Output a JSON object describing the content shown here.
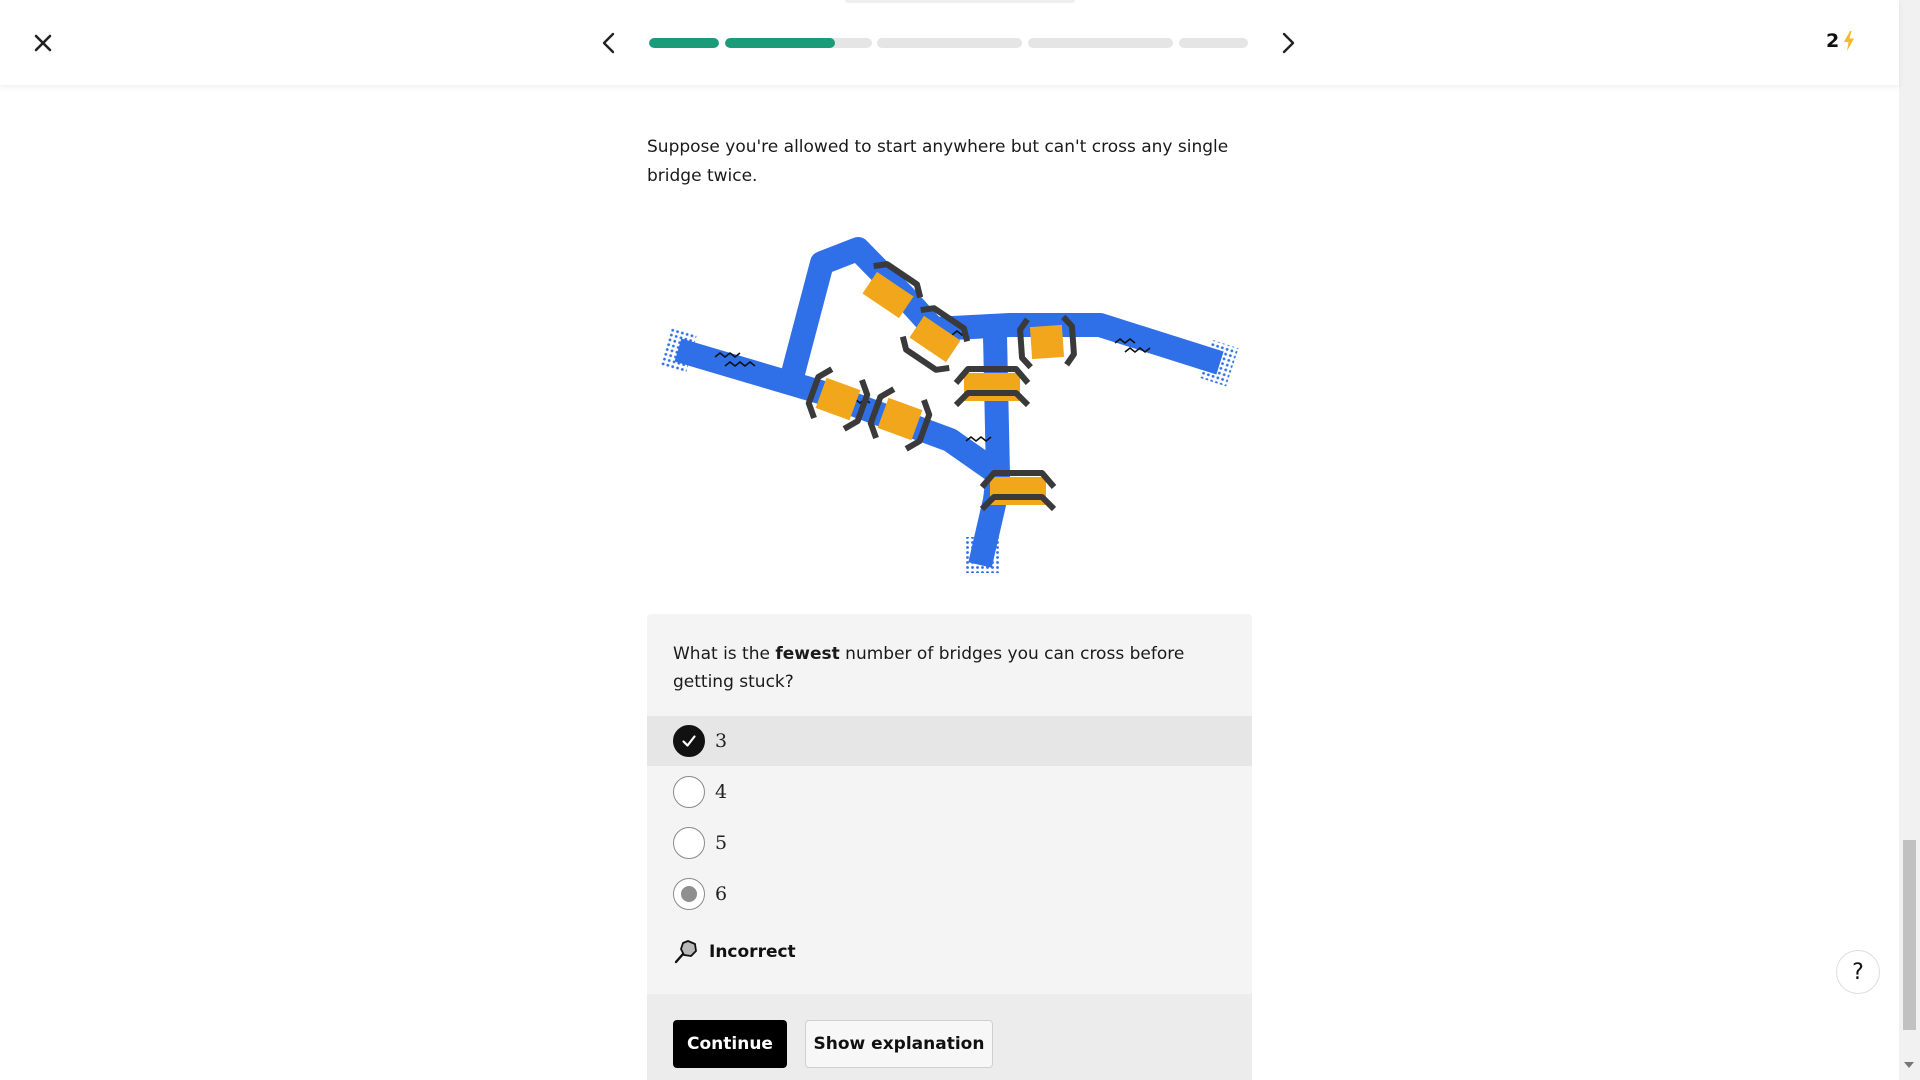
{
  "header": {
    "close_icon": "close-icon",
    "prev_icon": "chevron-left-icon",
    "next_icon": "chevron-right-icon",
    "progress_segments": [
      {
        "fill": 1.0
      },
      {
        "fill": 0.75
      },
      {
        "fill": 0.0
      },
      {
        "fill": 0.0
      },
      {
        "fill": 0.0
      }
    ],
    "energy_count": "2",
    "energy_icon": "lightning-bolt-icon",
    "accent_color": "#1a9c7a",
    "bolt_color": "#f5b82e"
  },
  "content": {
    "intro": "Suppose you're allowed to start anywhere but can't cross any single bridge twice."
  },
  "quiz": {
    "question_before": "What is the ",
    "question_bold": "fewest",
    "question_after": " number of bridges you can cross before getting stuck?",
    "options": [
      {
        "label": "3",
        "state": "selected-correct"
      },
      {
        "label": "4",
        "state": "unselected"
      },
      {
        "label": "5",
        "state": "unselected"
      },
      {
        "label": "6",
        "state": "attempted-wrong"
      }
    ],
    "feedback_icon": "magnifier-icon",
    "feedback": "Incorrect",
    "continue_label": "Continue",
    "explain_label": "Show explanation"
  },
  "help": {
    "label": "?"
  },
  "colors": {
    "river": "#2f6fe8",
    "bridge": "#f2a61c",
    "rail": "#3a3a3a"
  }
}
